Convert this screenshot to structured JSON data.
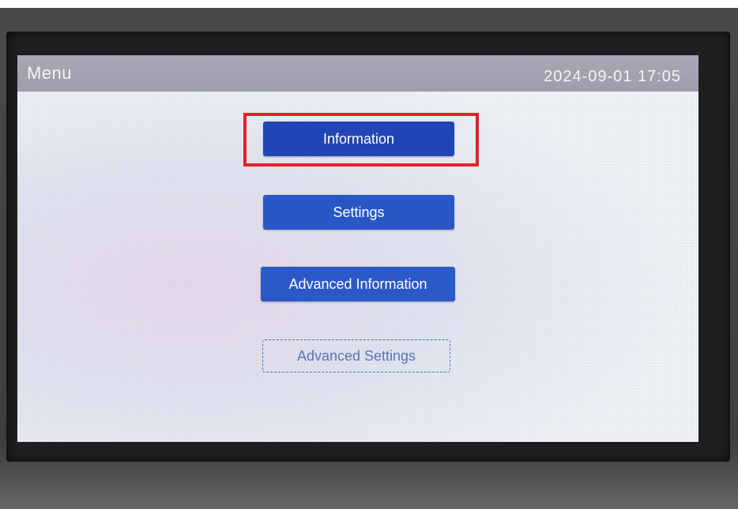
{
  "header": {
    "title": "Menu",
    "datetime": "2024-09-01  17:05"
  },
  "menu": {
    "items": [
      {
        "label": "Information",
        "selected": true
      },
      {
        "label": "Settings"
      },
      {
        "label": "Advanced Information"
      },
      {
        "label": "Advanced Settings",
        "style": "outlined"
      }
    ]
  },
  "colors": {
    "button_blue": "#2a53c3",
    "title_bar": "#a9a7b4",
    "highlight_red": "#e02228",
    "outline_button": "#5a76b7"
  }
}
